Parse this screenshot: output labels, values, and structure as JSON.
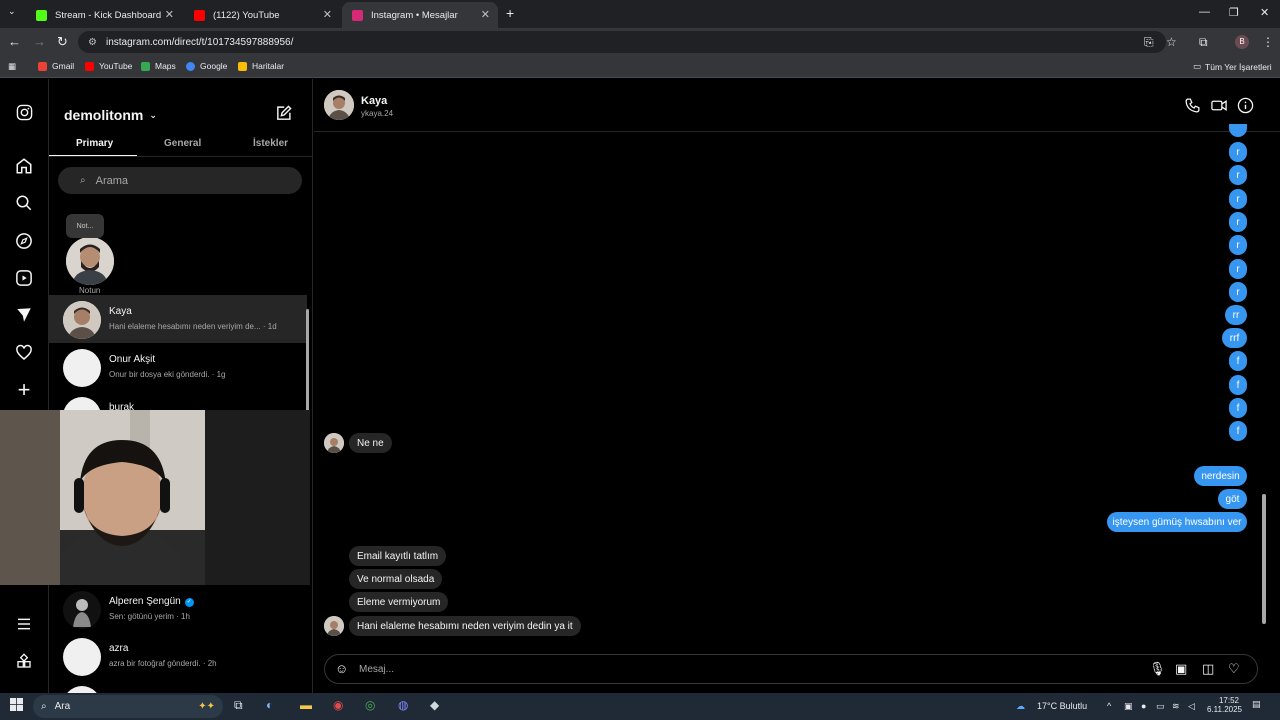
{
  "browser": {
    "tabs": [
      {
        "title": "Stream - Kick Dashboard",
        "favicon_color": "#53fc18"
      },
      {
        "title": "(1122) YouTube",
        "favicon_color": "#ff0000"
      },
      {
        "title": "Instagram • Mesajlar",
        "favicon_color": "#d62976"
      }
    ],
    "url": "instagram.com/direct/t/101734597888956/",
    "bookmarks": [
      {
        "label": "Gmail",
        "color": "#ea4335"
      },
      {
        "label": "YouTube",
        "color": "#ff0000"
      },
      {
        "label": "Maps",
        "color": "#34a853"
      },
      {
        "label": "Google",
        "color": "#4285f4"
      },
      {
        "label": "Haritalar",
        "color": "#fbbc04"
      }
    ],
    "bookmarks_right": "Tüm Yer İşaretleri",
    "profile_initial": "B"
  },
  "inbox": {
    "username": "demolitonm",
    "tabs": [
      "Primary",
      "General",
      "İstekler"
    ],
    "search_placeholder": "Arama",
    "note_text": "Not...",
    "note_label": "Notun",
    "conversations": [
      {
        "name": "Kaya",
        "preview": "Hani elaleme hesabımı neden veriyim de... · 1d"
      },
      {
        "name": "Onur Akşit",
        "preview": "Onur bir dosya eki gönderdi. · 1g"
      },
      {
        "name": "burak",
        "preview": ""
      },
      {
        "name": "Alperen Şengün",
        "preview": "Sen: götünü yerim · 1h"
      },
      {
        "name": "azra",
        "preview": "azra bir fotoğraf gönderdi. · 2h"
      }
    ]
  },
  "chat": {
    "name": "Kaya",
    "handle": "ykaya.24",
    "outgoing_top": [
      "r",
      "r",
      "r",
      "r",
      "r",
      "r",
      "r",
      "rr",
      "rrf",
      "f",
      "f",
      "f",
      "f"
    ],
    "incoming_1": "Ne ne",
    "outgoing_mid": [
      "nerdesin",
      "göt",
      "işteysen gümüş hwsabını ver"
    ],
    "incoming_2": [
      "Email kayıtlı tatlım",
      "Ve normal olsada",
      "Eleme vermiyorum",
      "Hani elaleme hesabımı neden veriyim dedin ya it"
    ],
    "composer_placeholder": "Mesaj..."
  },
  "taskbar": {
    "search_label": "Ara",
    "weather": "17°C Bulutlu",
    "time": "17:52",
    "date": "6.11.2025"
  },
  "colors": {
    "outgoing_bubble": "#3797f0",
    "incoming_bubble": "#262626"
  }
}
